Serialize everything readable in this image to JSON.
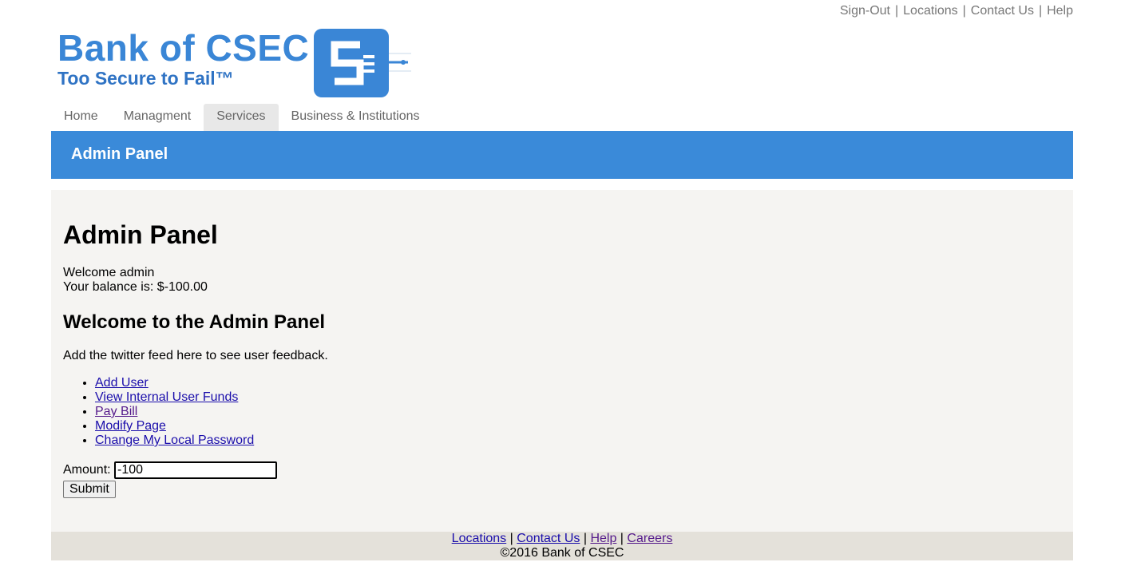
{
  "top_links": {
    "signout": "Sign-Out",
    "locations": "Locations",
    "contact": "Contact Us",
    "help": "Help",
    "separator": "|"
  },
  "logo": {
    "name": "Bank of CSEC",
    "tagline": "Too Secure to Fail™",
    "brand_color": "#3a86d6"
  },
  "nav": {
    "items": [
      {
        "label": "Home"
      },
      {
        "label": "Managment"
      },
      {
        "label": "Services"
      },
      {
        "label": "Business & Institutions"
      }
    ],
    "active": "Services"
  },
  "banner": {
    "title": "Admin Panel",
    "color": "#3a8ad9"
  },
  "main": {
    "heading": "Admin Panel",
    "welcome": "Welcome admin",
    "balance": "Your balance is: $-100.00",
    "subheading": "Welcome to the Admin Panel",
    "feed_note": "Add the twitter feed here to see user feedback.",
    "links": [
      {
        "label": "Add User"
      },
      {
        "label": "View Internal User Funds"
      },
      {
        "label": "Pay Bill"
      },
      {
        "label": "Modify Page"
      },
      {
        "label": "Change My Local Password"
      }
    ],
    "amount_label": "Amount:",
    "amount_value": "-100",
    "submit_label": "Submit"
  },
  "footer": {
    "links": [
      {
        "label": "Locations"
      },
      {
        "label": "Contact Us"
      },
      {
        "label": "Help"
      },
      {
        "label": "Careers"
      }
    ],
    "separator": "|",
    "copyright": "©2016 Bank of CSEC"
  }
}
